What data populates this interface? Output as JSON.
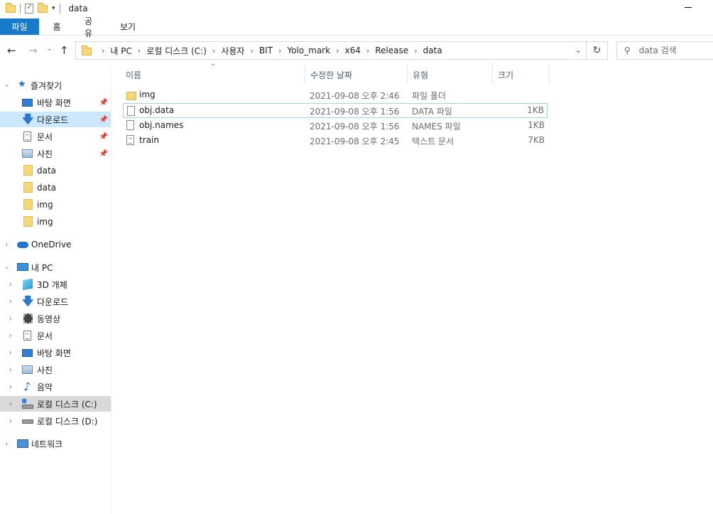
{
  "window": {
    "title": "data"
  },
  "ribbon": {
    "tabs": [
      "파일",
      "홈",
      "공유",
      "보기"
    ]
  },
  "address": {
    "crumbs": [
      "내 PC",
      "로컬 디스크 (C:)",
      "사용자",
      "BIT",
      "Yolo_mark",
      "x64",
      "Release",
      "data"
    ]
  },
  "search": {
    "placeholder": "data 검색"
  },
  "sidebar": {
    "quick_access": "즐겨찾기",
    "quick_items": [
      "바탕 화면",
      "다운로드",
      "문서",
      "사진",
      "data",
      "data",
      "img",
      "img"
    ],
    "onedrive": "OneDrive",
    "this_pc": "내 PC",
    "pc_items": [
      "3D 개체",
      "다운로드",
      "동영상",
      "문서",
      "바탕 화면",
      "사진",
      "음악",
      "로컬 디스크 (C:)",
      "로컬 디스크 (D:)"
    ],
    "network": "네트워크"
  },
  "columns": {
    "name": "이름",
    "modified": "수정한 날짜",
    "type": "유형",
    "size": "크기"
  },
  "files": [
    {
      "name": "img",
      "modified": "2021-09-08 오후 2:46",
      "type": "파일 폴더",
      "size": "",
      "icon": "folder-icon"
    },
    {
      "name": "obj.data",
      "modified": "2021-09-08 오후 1:56",
      "type": "DATA 파일",
      "size": "1KB",
      "icon": "file-icon"
    },
    {
      "name": "obj.names",
      "modified": "2021-09-08 오후 1:56",
      "type": "NAMES 파일",
      "size": "1KB",
      "icon": "file-icon"
    },
    {
      "name": "train",
      "modified": "2021-09-08 오후 2:45",
      "type": "텍스트 문서",
      "size": "7KB",
      "icon": "text-file-icon"
    }
  ]
}
